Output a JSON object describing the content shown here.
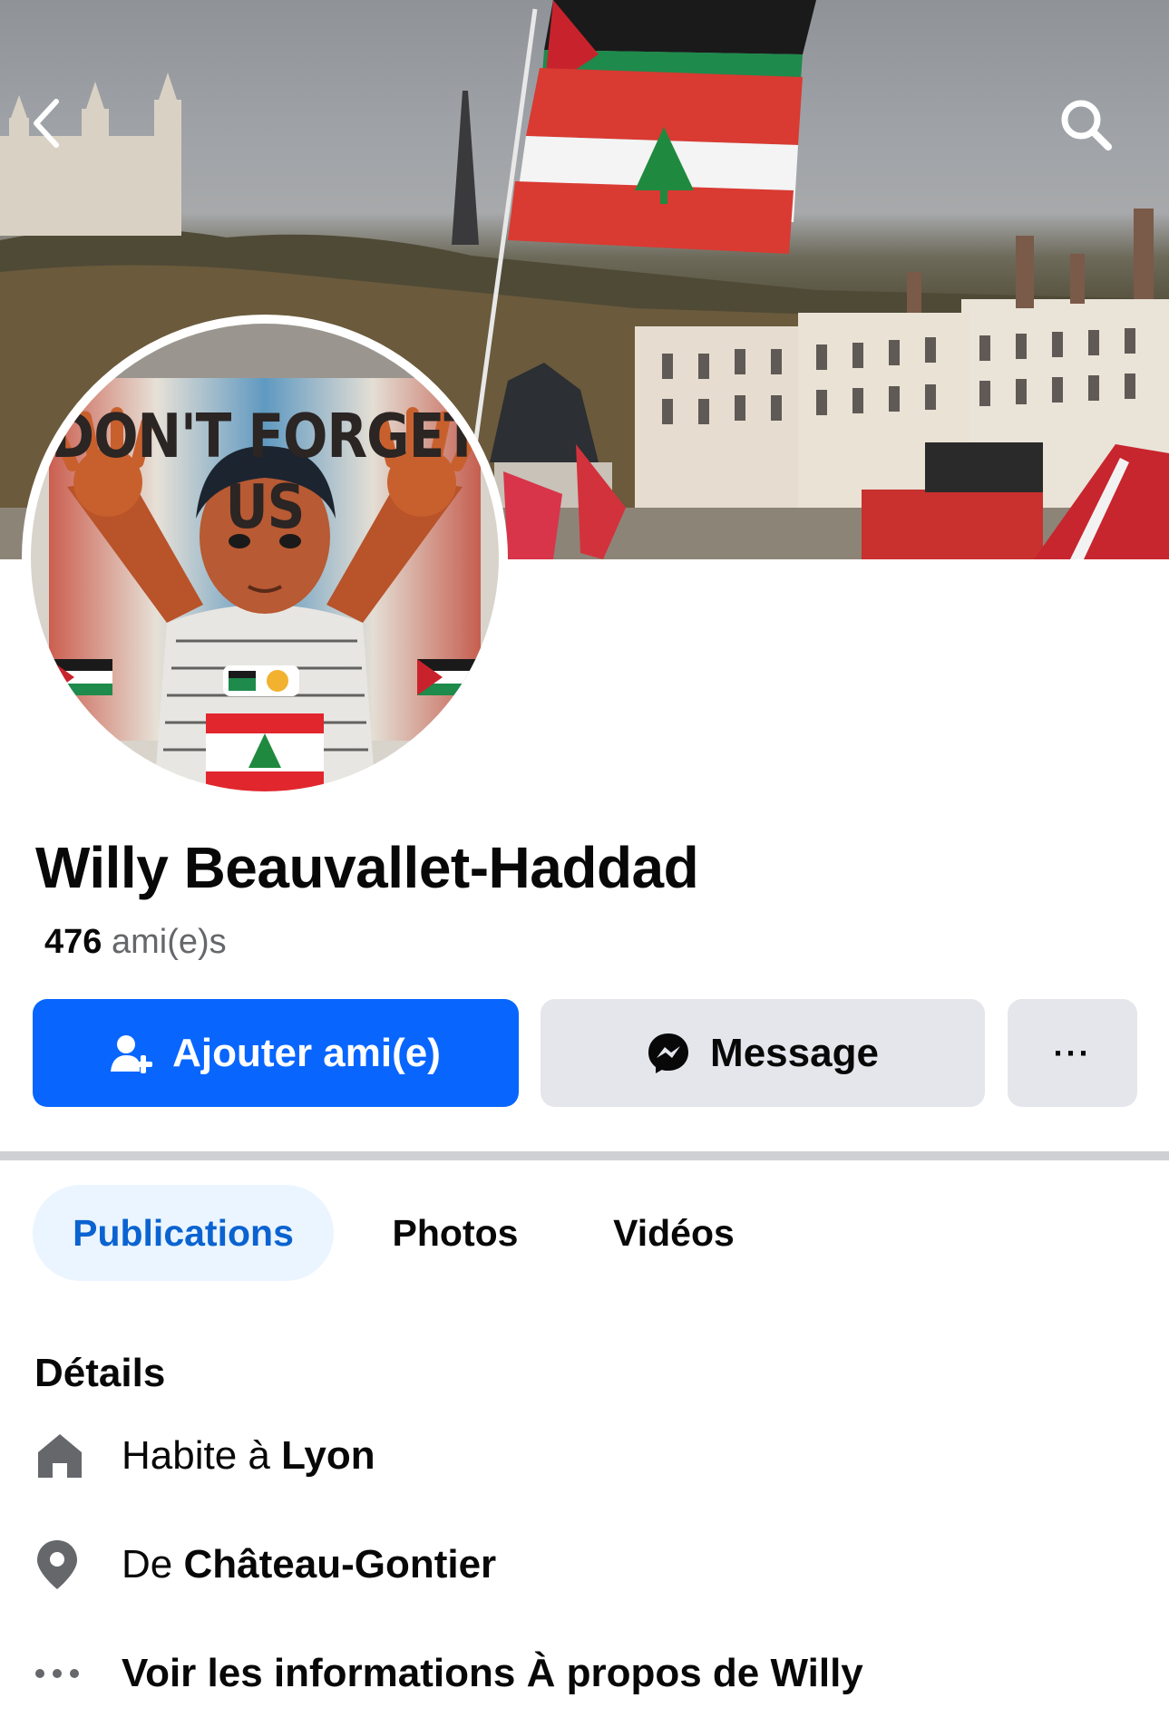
{
  "header": {
    "back_icon": "chevron-left-icon",
    "search_icon": "search-icon"
  },
  "avatar": {
    "quote": "DON'T FORGET US"
  },
  "profile": {
    "name": "Willy Beauvallet-Haddad",
    "friends_count": "476",
    "friends_label": "ami(e)s"
  },
  "actions": {
    "add_friend": "Ajouter ami(e)",
    "message": "Message",
    "more": "···"
  },
  "tabs": [
    {
      "label": "Publications",
      "active": true
    },
    {
      "label": "Photos",
      "active": false
    },
    {
      "label": "Vidéos",
      "active": false
    }
  ],
  "details": {
    "title": "Détails",
    "lives_prefix": "Habite à",
    "lives_city": "Lyon",
    "from_prefix": "De",
    "from_city": "Château-Gontier",
    "about_link": "Voir les informations À propos de Willy"
  },
  "colors": {
    "primary_blue": "#0866ff",
    "active_tab_bg": "#ebf5ff",
    "active_tab_text": "#0a63d1",
    "secondary_button": "#e4e6eb"
  }
}
